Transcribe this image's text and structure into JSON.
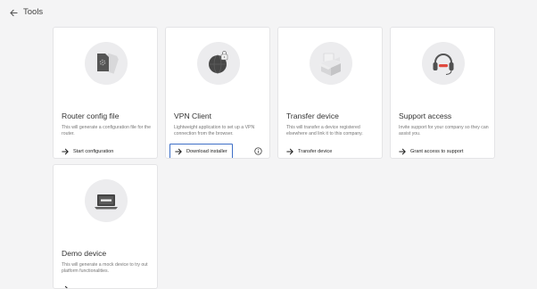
{
  "header": {
    "title": "Tools",
    "back_icon": "arrow-left-icon"
  },
  "cards": [
    {
      "title": "Router config file",
      "description": "This will generate a configuration file for the router.",
      "action": "Start configuration",
      "icon": "sim-card-illustration"
    },
    {
      "title": "VPN Client",
      "description": "Lightweight application to set up a VPN connection from the browser.",
      "action": "Download installer",
      "icon": "vpn-globe-lock-illustration",
      "info_icon": "info-icon"
    },
    {
      "title": "Transfer device",
      "description": "This will transfer a device registered elsewhere and link it to this company.",
      "action": "Transfer device",
      "icon": "open-box-illustration"
    },
    {
      "title": "Support access",
      "description": "Invite support for your company so they can assist you.",
      "action": "Grant access to support",
      "icon": "headset-illustration"
    },
    {
      "title": "Demo device",
      "description": "This will generate a mock device to try out platform functionalities.",
      "action": "",
      "icon": "laptop-illustration"
    }
  ],
  "colors": {
    "background": "#f4f4f5",
    "card": "#ffffff",
    "focus_outline": "#3e6fc7",
    "illustration_bg": "#ececee"
  }
}
